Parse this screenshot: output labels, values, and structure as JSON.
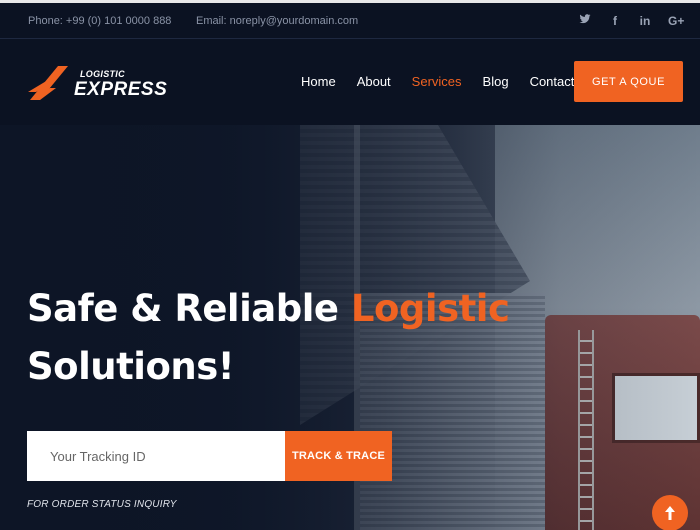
{
  "topbar": {
    "phone": "Phone: +99 (0) 101 0000 888",
    "email": "Email: noreply@yourdomain.com",
    "socials": [
      {
        "icon": "twitter-icon",
        "glyph": "🐦"
      },
      {
        "icon": "facebook-icon",
        "glyph": "f"
      },
      {
        "icon": "linkedin-icon",
        "glyph": "in"
      },
      {
        "icon": "google-plus-icon",
        "glyph": "G+"
      }
    ]
  },
  "logo": {
    "small": "LOGISTIC",
    "big": "EXPRESS"
  },
  "nav": {
    "items": [
      {
        "label": "Home",
        "active": false
      },
      {
        "label": "About",
        "active": false
      },
      {
        "label": "Services",
        "active": true
      },
      {
        "label": "Blog",
        "active": false
      },
      {
        "label": "Contact",
        "active": false
      }
    ],
    "cta": "GET A QOUE"
  },
  "hero": {
    "line1_plain": "Safe & Reliable ",
    "line1_highlight": "Logistic",
    "line2": "Solutions!",
    "tracking_placeholder": "Your Tracking ID",
    "track_button": "TRACK & TRACE",
    "inquiry_note": "FOR ORDER STATUS INQUIRY"
  },
  "scroll_top_icon": "arrow-up-icon",
  "colors": {
    "accent": "#f06322",
    "background": "#0b1222"
  }
}
